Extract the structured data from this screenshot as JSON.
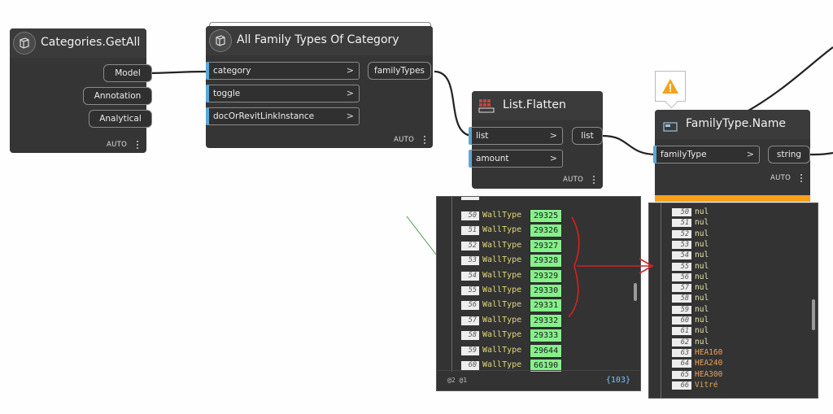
{
  "nodes": {
    "categories": {
      "title": "Categories.GetAll",
      "outputs": [
        "Model",
        "Annotation",
        "Analytical"
      ],
      "auto": "AUTO"
    },
    "family_types": {
      "title": "All Family Types Of Category",
      "inputs": [
        "category",
        "toggle",
        "docOrRevitLinkInstance"
      ],
      "output": "familyTypes",
      "auto": "AUTO"
    },
    "flatten": {
      "title": "List.Flatten",
      "inputs": [
        "list",
        "amount"
      ],
      "output": "list",
      "auto": "AUTO"
    },
    "family_type_name": {
      "title": "FamilyType.Name",
      "inputs": [
        "familyType"
      ],
      "output": "string",
      "auto": "AUTO"
    }
  },
  "arrow_glyph": ">",
  "flatten_preview": {
    "rows": [
      {
        "idx": "50",
        "type": "WallType",
        "val": "29325"
      },
      {
        "idx": "51",
        "type": "WallType",
        "val": "29326"
      },
      {
        "idx": "52",
        "type": "WallType",
        "val": "29327"
      },
      {
        "idx": "53",
        "type": "WallType",
        "val": "29328"
      },
      {
        "idx": "54",
        "type": "WallType",
        "val": "29329"
      },
      {
        "idx": "55",
        "type": "WallType",
        "val": "29330"
      },
      {
        "idx": "56",
        "type": "WallType",
        "val": "29331"
      },
      {
        "idx": "57",
        "type": "WallType",
        "val": "29332"
      },
      {
        "idx": "58",
        "type": "WallType",
        "val": "29333"
      },
      {
        "idx": "59",
        "type": "WallType",
        "val": "29644"
      },
      {
        "idx": "60",
        "type": "WallType",
        "val": "66190"
      }
    ],
    "footer_levels": "@2 @1",
    "footer_count": "{103}"
  },
  "name_preview": {
    "rows": [
      {
        "idx": "50",
        "val": "nul",
        "kind": "null"
      },
      {
        "idx": "51",
        "val": "nul",
        "kind": "null"
      },
      {
        "idx": "52",
        "val": "nul",
        "kind": "null"
      },
      {
        "idx": "53",
        "val": "nul",
        "kind": "null"
      },
      {
        "idx": "54",
        "val": "nul",
        "kind": "null"
      },
      {
        "idx": "55",
        "val": "nul",
        "kind": "null"
      },
      {
        "idx": "56",
        "val": "nul",
        "kind": "null"
      },
      {
        "idx": "57",
        "val": "nul",
        "kind": "null"
      },
      {
        "idx": "58",
        "val": "nul",
        "kind": "null"
      },
      {
        "idx": "59",
        "val": "nul",
        "kind": "null"
      },
      {
        "idx": "60",
        "val": "nul",
        "kind": "null"
      },
      {
        "idx": "61",
        "val": "nul",
        "kind": "null"
      },
      {
        "idx": "62",
        "val": "nul",
        "kind": "null"
      },
      {
        "idx": "63",
        "val": "HEA160",
        "kind": "string"
      },
      {
        "idx": "64",
        "val": "HEA240",
        "kind": "string"
      },
      {
        "idx": "65",
        "val": "HEA300",
        "kind": "string"
      },
      {
        "idx": "66",
        "val": "Vitré",
        "kind": "string"
      }
    ]
  },
  "colors": {
    "node_body": "#353535",
    "port_marker": "#5ca7d5",
    "value_green": "#86f08a",
    "warning_orange": "#f5a21a",
    "annotation_red": "#d92020"
  },
  "icons": {
    "warning": "warning-icon",
    "node": "node-type-icon"
  }
}
